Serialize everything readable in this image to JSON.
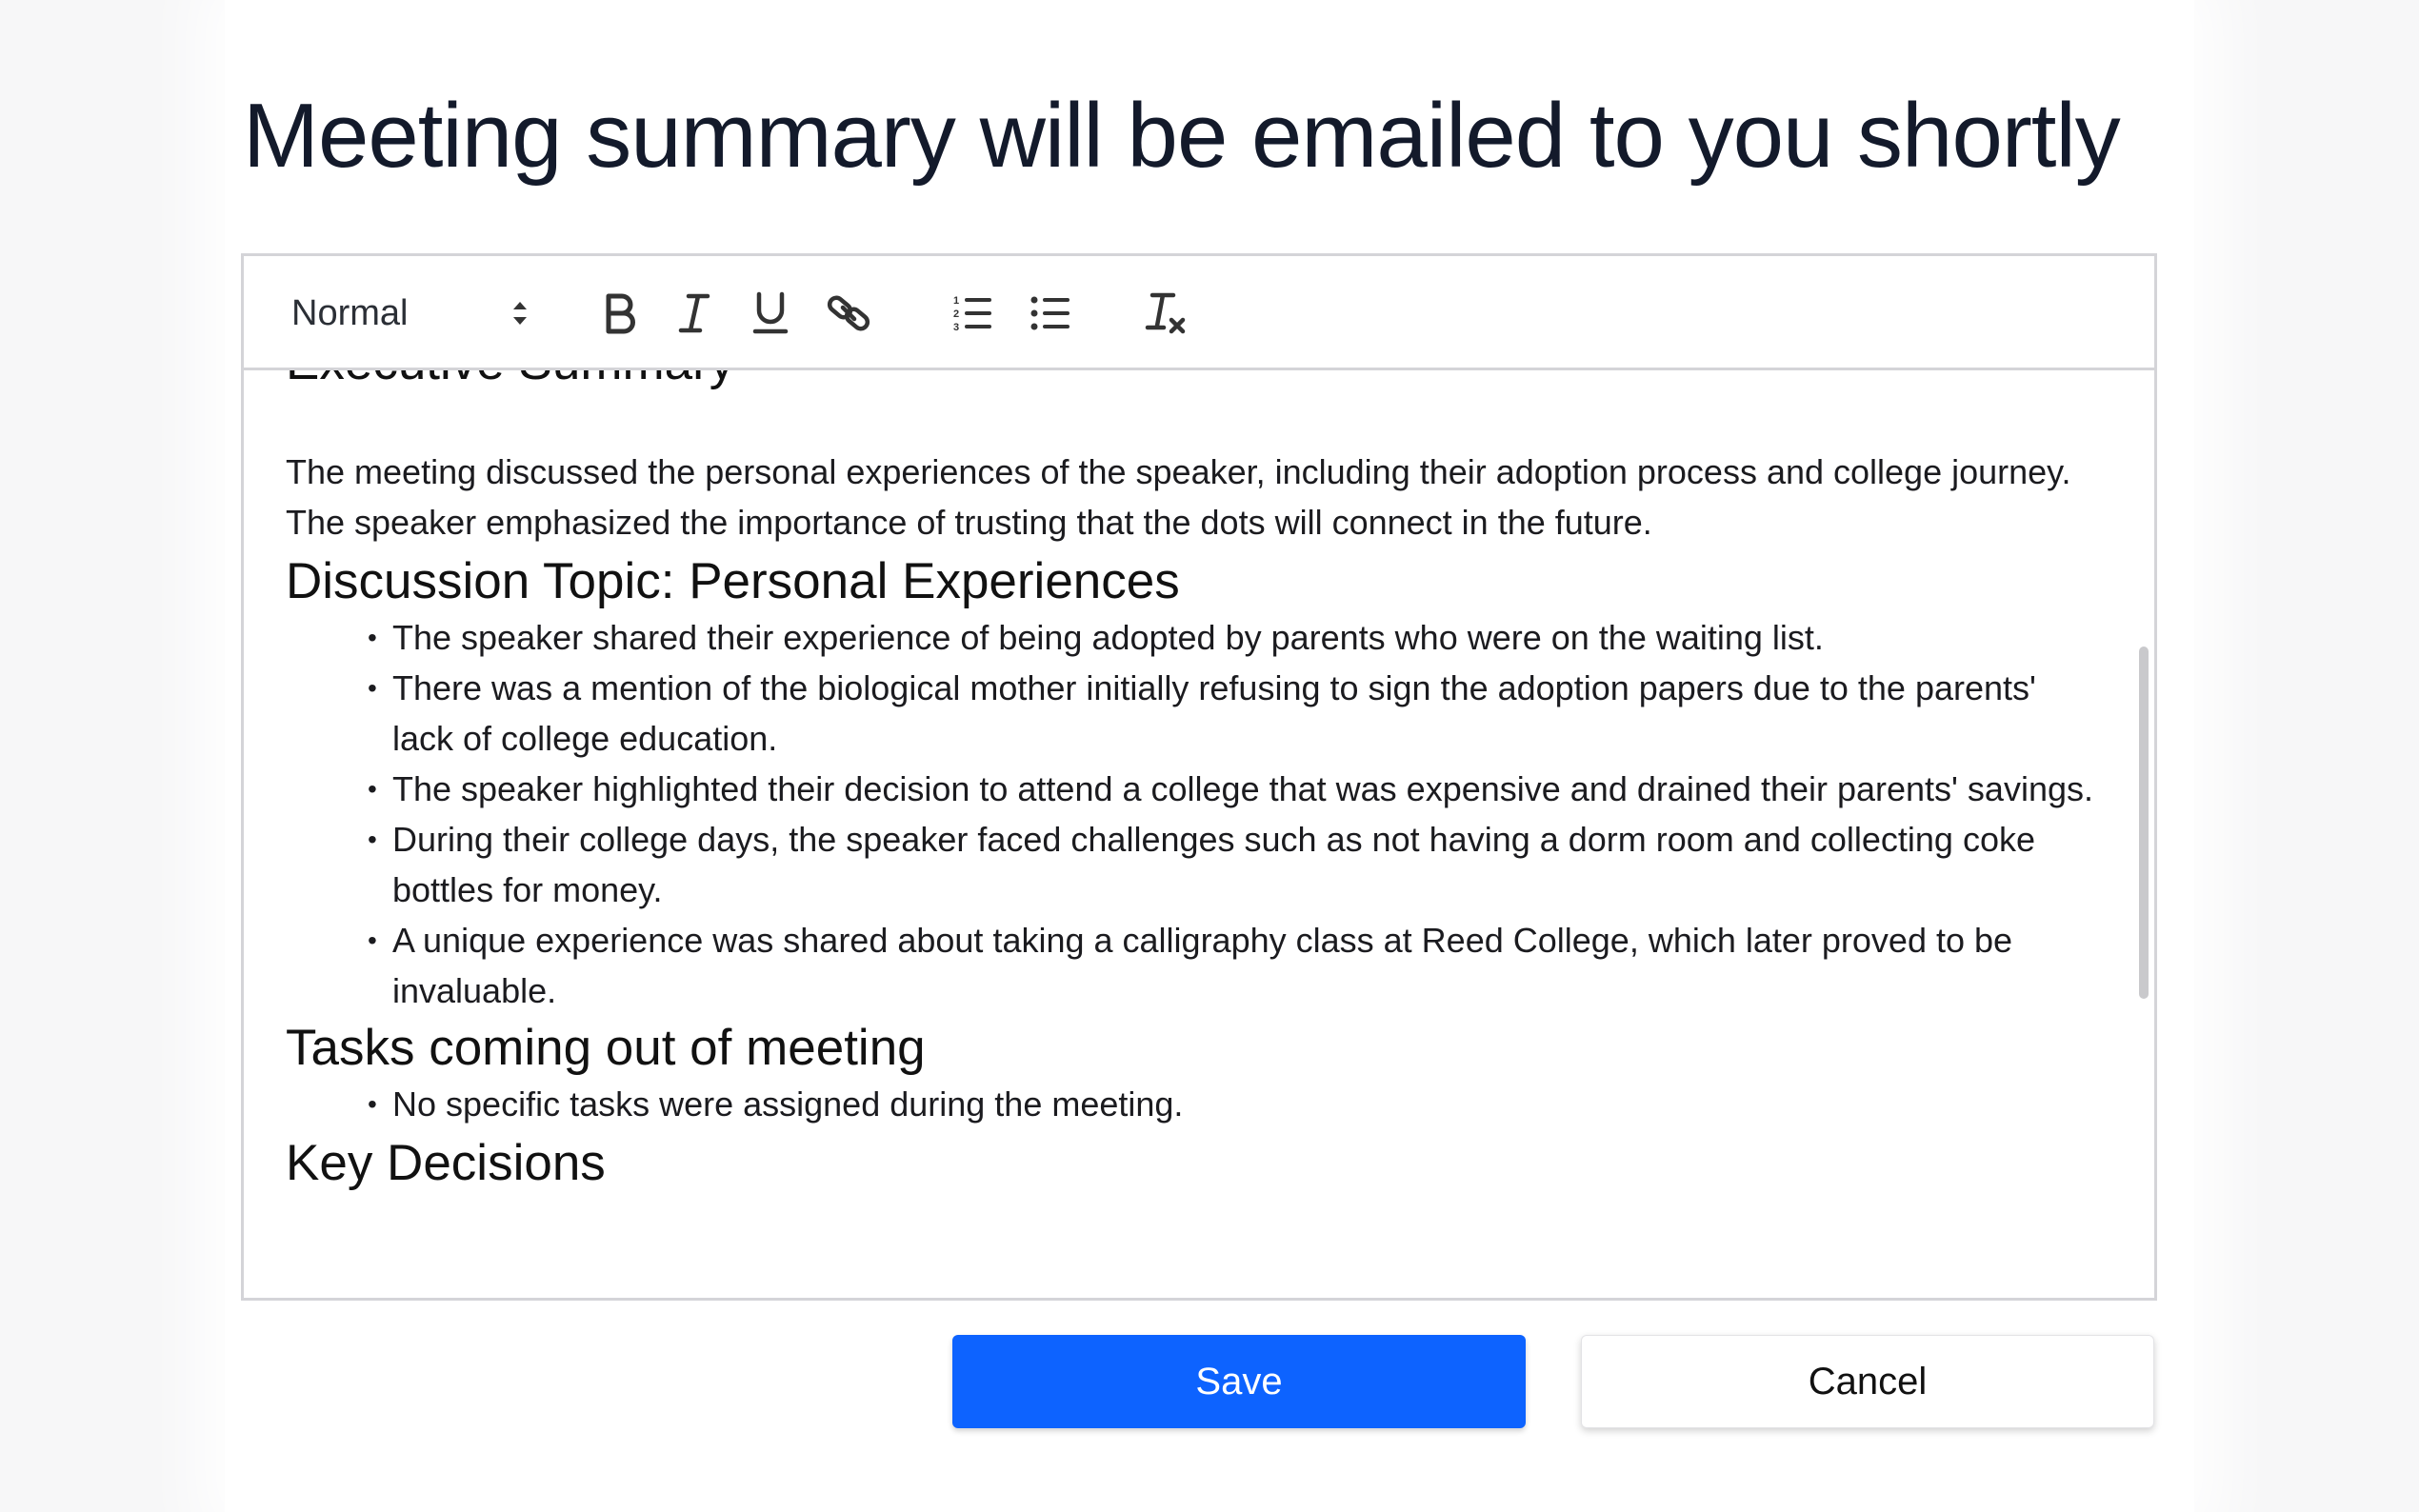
{
  "dialog": {
    "title": "Meeting summary will be emailed to you shortly"
  },
  "toolbar": {
    "format_value": "Normal",
    "icons": {
      "format_arrows": "updown-chevron-icon",
      "bold": "bold-icon",
      "italic": "italic-icon",
      "underline": "underline-icon",
      "link": "link-icon",
      "ordered_list": "ordered-list-icon",
      "bullet_list": "bullet-list-icon",
      "clear_format": "clear-formatting-icon"
    }
  },
  "document": {
    "executive_heading": "Executive Summary",
    "executive_text": "The meeting discussed the personal experiences of the speaker, including their adoption process and college journey. The speaker emphasized the importance of trusting that the dots will connect in the future.",
    "discussion_heading": "Discussion Topic: Personal Experiences",
    "discussion_items": [
      "The speaker shared their experience of being adopted by parents who were on the waiting list.",
      "There was a mention of the biological mother initially refusing to sign the adoption papers due to the parents' lack of college education.",
      "The speaker highlighted their decision to attend a college that was expensive and drained their parents' savings.",
      "During their college days, the speaker faced challenges such as not having a dorm room and collecting coke bottles for money.",
      "A unique experience was shared about taking a calligraphy class at Reed College, which later proved to be invaluable."
    ],
    "tasks_heading": "Tasks coming out of meeting",
    "tasks_items": [
      "No specific tasks were assigned during the meeting."
    ],
    "decisions_heading": "Key Decisions"
  },
  "actions": {
    "save_label": "Save",
    "cancel_label": "Cancel"
  },
  "colors": {
    "primary": "#0d63ff",
    "title_text": "#131a2b",
    "border": "#d4d4d8"
  }
}
